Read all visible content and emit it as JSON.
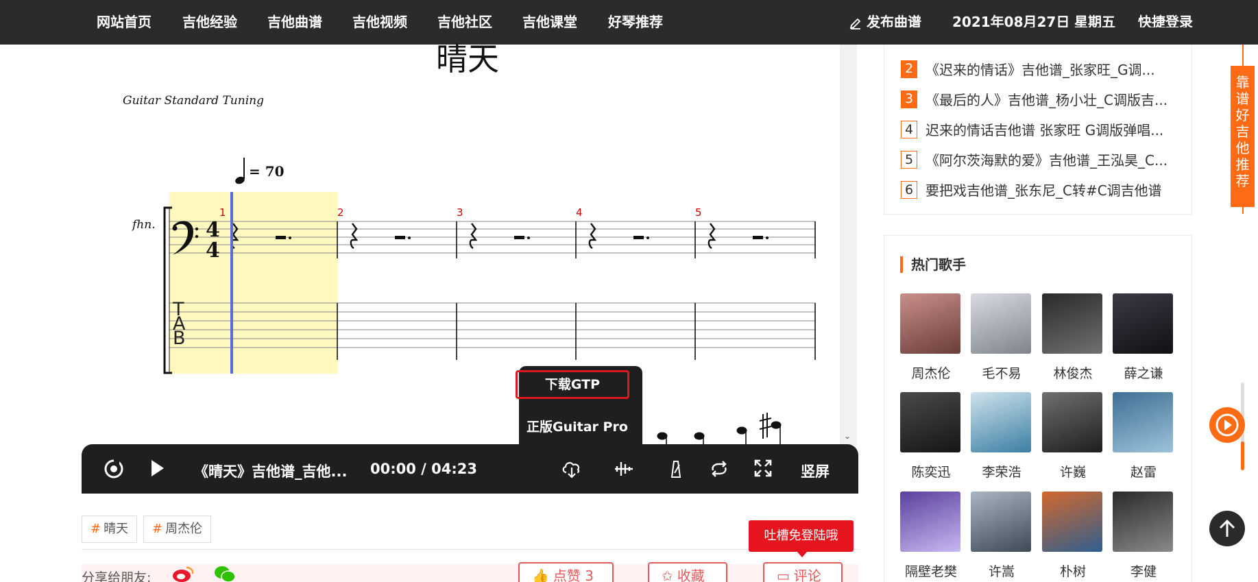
{
  "nav": {
    "items": [
      "网站首页",
      "吉他经验",
      "吉他曲谱",
      "吉他视频",
      "吉他社区",
      "吉他课堂",
      "好琴推荐"
    ],
    "publish": "发布曲谱",
    "date": "2021年08月27日",
    "weekday": "星期五",
    "login": "快捷登录"
  },
  "sheet": {
    "title": "晴天",
    "tuning": "Guitar Standard Tuning",
    "tempo": "= 70",
    "instrument": "fhn.",
    "bar_numbers": [
      "1",
      "2",
      "3",
      "4",
      "5"
    ],
    "tab_letters": [
      "T",
      "A",
      "B"
    ]
  },
  "popup": {
    "download": "下载GTP",
    "pro": "正版Guitar Pro"
  },
  "player": {
    "title": "《晴天》吉他谱_吉他...",
    "time": "00:00 / 04:23",
    "vertical": "竖屏",
    "progress": 0
  },
  "tags": [
    "晴天",
    "周杰伦"
  ],
  "share": {
    "label": "分享给朋友:",
    "like": "点赞 3",
    "collect": "收藏",
    "comment": "评论",
    "tucao": "吐槽免登陆哦"
  },
  "ranking": [
    {
      "num": "2",
      "text": "《迟来的情话》吉他谱_张家旺_G调...",
      "hot": true
    },
    {
      "num": "3",
      "text": "《最后的人》吉他谱_杨小壮_C调版吉...",
      "hot": true
    },
    {
      "num": "4",
      "text": "迟来的情话吉他谱 张家旺 G调版弹唱...",
      "hot": false
    },
    {
      "num": "5",
      "text": "《阿尔茨海默的爱》吉他谱_王泓昊_C...",
      "hot": false
    },
    {
      "num": "6",
      "text": "要把戏吉他谱_张东尼_C转#C调吉他谱",
      "hot": false
    }
  ],
  "singers": {
    "title": "热门歌手",
    "list": [
      "周杰伦",
      "毛不易",
      "林俊杰",
      "薛之谦",
      "陈奕迅",
      "李荣浩",
      "许巍",
      "赵雷",
      "隔壁老樊",
      "许嵩",
      "朴树",
      "李健"
    ]
  },
  "side_banner": "靠谱好吉他推荐",
  "colors": {
    "accent": "#ff6a14",
    "nav_bg": "#2b2b2b",
    "player_bg": "#1f1f1f",
    "bar_number": "#c80000",
    "highlight": "#fff9bf",
    "cursor": "#5b6ad6",
    "red": "#e5141e"
  }
}
